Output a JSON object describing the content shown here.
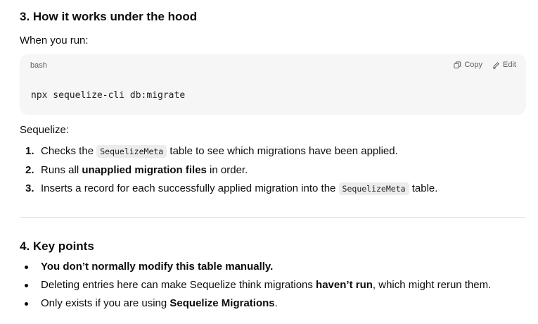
{
  "section3": {
    "heading": "3. How it works under the hood",
    "intro": "When you run:",
    "code": {
      "language": "bash",
      "copy_label": "Copy",
      "edit_label": "Edit",
      "command": "npx sequelize-cli db:migrate"
    },
    "lead": "Sequelize:",
    "steps": [
      {
        "num": "1.",
        "pre": "Checks the ",
        "code": "SequelizeMeta",
        "post": " table to see which migrations have been applied."
      },
      {
        "num": "2.",
        "pre": "Runs all ",
        "bold": "unapplied migration files",
        "post": " in order."
      },
      {
        "num": "3.",
        "pre": "Inserts a record for each successfully applied migration into the ",
        "code": "SequelizeMeta",
        "post": " table."
      }
    ]
  },
  "section4": {
    "heading": "4. Key points",
    "points": [
      {
        "bold": "You don’t normally modify this table manually."
      },
      {
        "pre": "Deleting entries here can make Sequelize think migrations ",
        "bold": "haven’t run",
        "post": ", which might rerun them."
      },
      {
        "pre": "Only exists if you are using ",
        "bold": "Sequelize Migrations",
        "post": "."
      }
    ]
  }
}
